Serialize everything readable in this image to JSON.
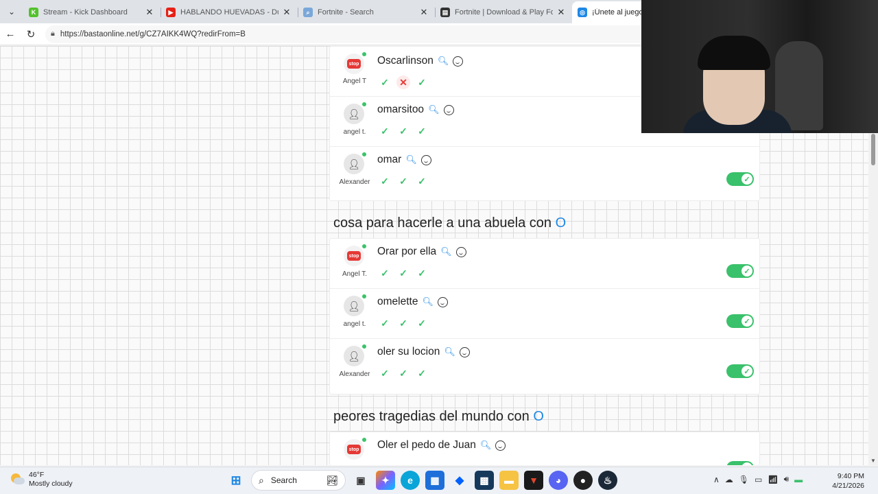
{
  "browser": {
    "tabs": [
      {
        "title": "Stream - Kick Dashboard",
        "favicon_color": "#53c22c",
        "favicon_glyph": "K"
      },
      {
        "title": "HABLANDO HUEVADAS - Duodéc",
        "favicon_color": "#e62117",
        "favicon_glyph": "▶"
      },
      {
        "title": "Fortnite - Search",
        "favicon_color": "#7aa7d9",
        "favicon_glyph": "⌕"
      },
      {
        "title": "Fortnite | Download & Play For Fre",
        "favicon_color": "#333333",
        "favicon_glyph": "▤"
      },
      {
        "title": "¡Únete al juego Ba",
        "favicon_color": "#1e88e5",
        "favicon_glyph": "◎"
      }
    ],
    "url": "https://bastaonline.net/g/CZ7AIKK4WQ?redirFrom=B"
  },
  "sections": [
    {
      "category": "",
      "letter": "",
      "answers": [
        {
          "text": "Oscarlinson",
          "player": "Angel T",
          "avatar": "stop-avatar-icon",
          "votes": [
            "yes",
            "no",
            "yes"
          ],
          "accepted": null
        },
        {
          "text": "omarsitoo",
          "player": "angel t.",
          "avatar": "user-avatar-icon",
          "votes": [
            "yes",
            "yes",
            "yes"
          ],
          "accepted": true
        },
        {
          "text": "omar",
          "player": "Alexander",
          "avatar": "user-avatar-icon",
          "votes": [
            "yes",
            "yes",
            "yes"
          ],
          "accepted": true
        }
      ]
    },
    {
      "category": "cosa para hacerle a una abuela con",
      "letter": "O",
      "answers": [
        {
          "text": "Orar por ella",
          "player": "Angel T.",
          "avatar": "stop-avatar-icon",
          "votes": [
            "yes",
            "yes",
            "yes"
          ],
          "accepted": true
        },
        {
          "text": "omelette",
          "player": "angel t.",
          "avatar": "user-avatar-icon",
          "votes": [
            "yes",
            "yes",
            "yes"
          ],
          "accepted": true
        },
        {
          "text": "oler su locion",
          "player": "Alexander",
          "avatar": "user-avatar-icon",
          "votes": [
            "yes",
            "yes",
            "yes"
          ],
          "accepted": true
        }
      ]
    },
    {
      "category": "peores tragedias del mundo con",
      "letter": "O",
      "answers": [
        {
          "text": "Oler el pedo de Juan",
          "player": "",
          "avatar": "stop-avatar-icon",
          "votes": [],
          "accepted": true
        }
      ]
    }
  ],
  "stop_label": "stop",
  "taskbar": {
    "weather_temp": "46°F",
    "weather_desc": "Mostly cloudy",
    "search_label": "Search",
    "time": "9:40 PM",
    "date": "4/21/2026"
  }
}
